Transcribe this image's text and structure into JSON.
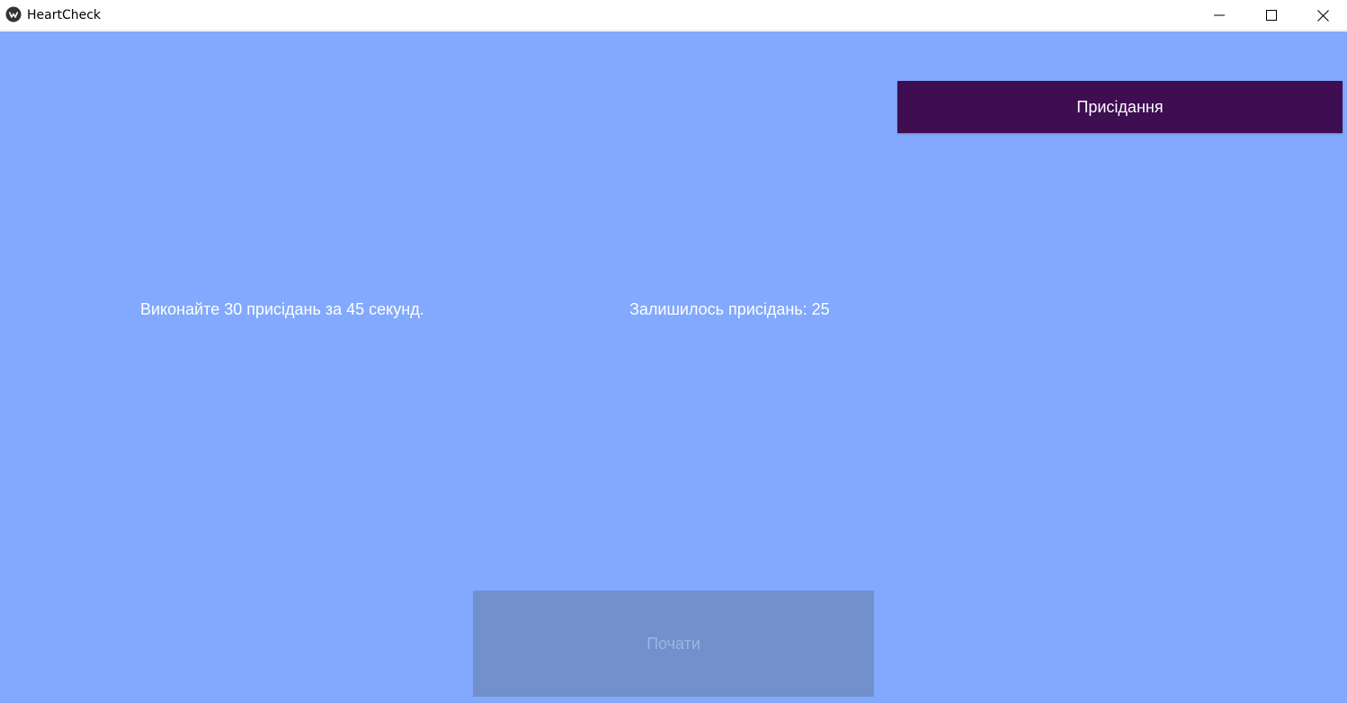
{
  "window": {
    "title": "HeartCheck",
    "icon": "kivy-logo-icon"
  },
  "header": {
    "exercise_label": "Присідання"
  },
  "main": {
    "instruction_text": "Виконайте 30 присідань за 45 секунд.",
    "remaining_text": "Залишилось присідань: 25",
    "start_label": "Почати",
    "start_enabled": false
  },
  "colors": {
    "background": "#82a9fe",
    "exercise_button": "#3f0d52",
    "start_button_disabled": "#7190cc",
    "start_text_disabled": "#9fb4e4",
    "text": "#ffffff"
  }
}
